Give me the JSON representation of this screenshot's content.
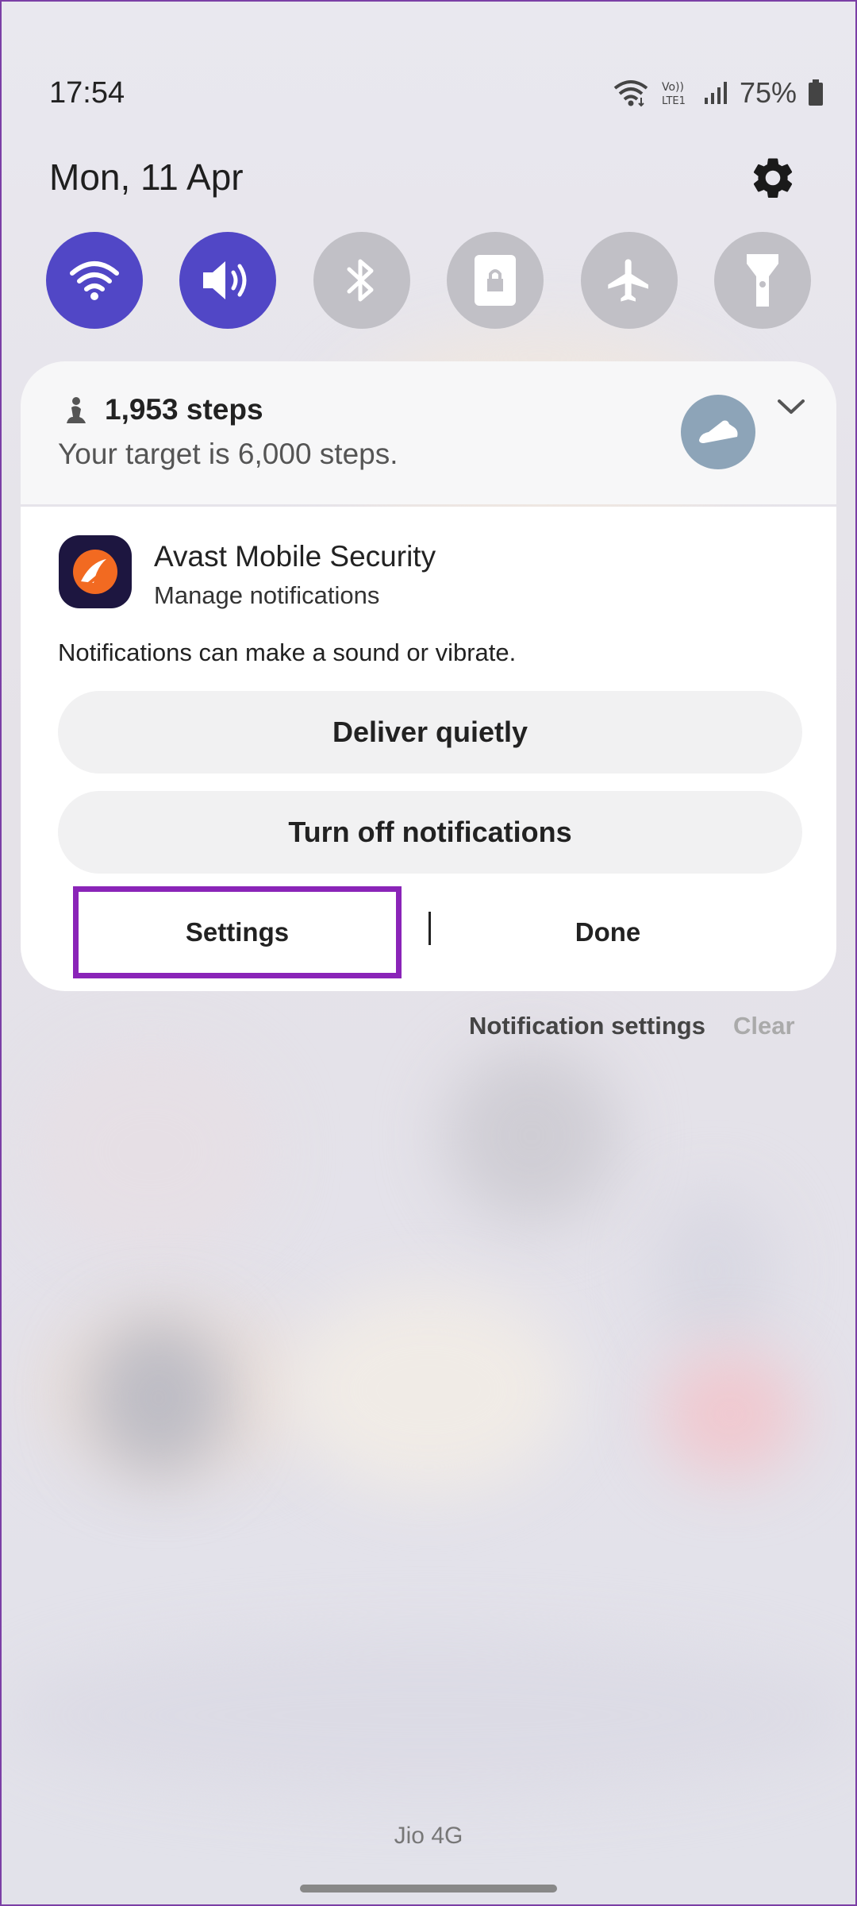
{
  "status_bar": {
    "time": "17:54",
    "battery_percent": "75%"
  },
  "header": {
    "date": "Mon, 11 Apr"
  },
  "quick_settings": [
    {
      "name": "wifi",
      "state": "on"
    },
    {
      "name": "sound",
      "state": "on"
    },
    {
      "name": "bluetooth",
      "state": "off"
    },
    {
      "name": "lock",
      "state": "off"
    },
    {
      "name": "airplane",
      "state": "off"
    },
    {
      "name": "flashlight",
      "state": "off"
    }
  ],
  "steps_notification": {
    "title": "1,953 steps",
    "subtitle": "Your target is 6,000 steps."
  },
  "app_notification": {
    "app_name": "Avast Mobile Security",
    "subtitle": "Manage notifications",
    "description": "Notifications can make a sound or vibrate.",
    "deliver_quietly_label": "Deliver quietly",
    "turn_off_label": "Turn off notifications",
    "settings_label": "Settings",
    "done_label": "Done"
  },
  "footer": {
    "notification_settings_label": "Notification settings",
    "clear_label": "Clear",
    "carrier": "Jio 4G"
  },
  "colors": {
    "accent": "#5147c6",
    "highlight": "#8a24b8",
    "avast_orange": "#f26a21"
  }
}
